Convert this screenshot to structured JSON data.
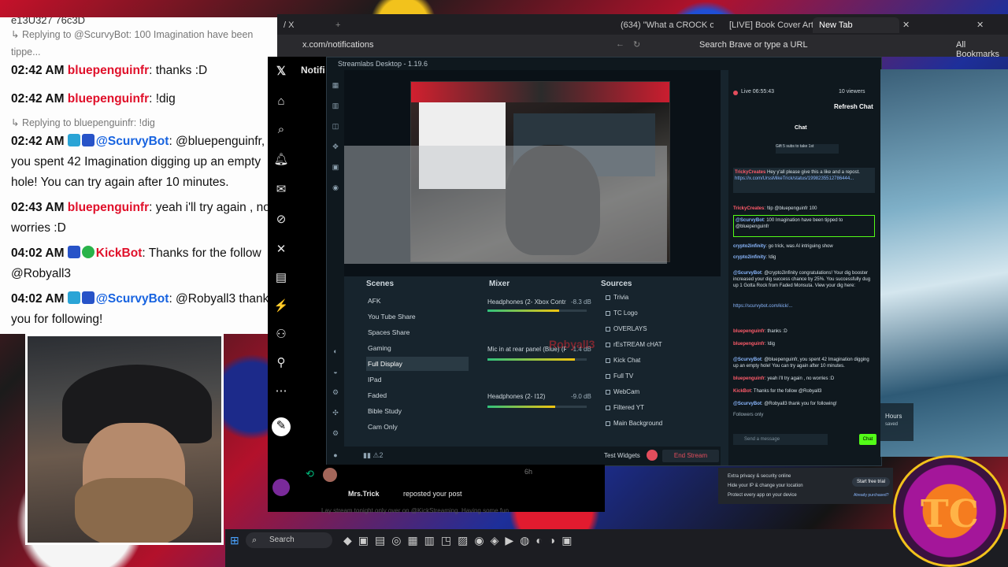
{
  "chat_overlay": {
    "top_cut": "e13U327 76c3D",
    "lines": [
      {
        "type": "reply",
        "text": "Replying to @ScurvyBot: 100 Imagination have been tippe..."
      },
      {
        "time": "02:42 AM",
        "user": "bluepenguinfr",
        "msg": ": thanks :D"
      },
      {
        "time": "02:42 AM",
        "user": "bluepenguinfr",
        "msg": ": !dig"
      },
      {
        "type": "reply",
        "text": "Replying to bluepenguinfr: !dig"
      },
      {
        "time": "02:42 AM",
        "user": "@ScurvyBot",
        "msg": ": @bluepenguinfr, you spent 42 Imagination digging up an empty hole! You can try again after 10 minutes."
      },
      {
        "time": "02:43 AM",
        "user": "bluepenguinfr",
        "msg": ": yeah i'll try again , no worries :D"
      },
      {
        "time": "04:02 AM",
        "user": "KickBot",
        "msg": ": Thanks for the follow @Robyall3"
      },
      {
        "time": "04:02 AM",
        "user": "@ScurvyBot",
        "msg": ": @Robyall3 thank you for following!"
      }
    ]
  },
  "browser": {
    "tabs": [
      {
        "label": "(634) \"What a CROCK of S***!\" Pi"
      },
      {
        "label": "[LIVE] Book Cover Art Project"
      },
      {
        "label": "New Tab",
        "active": true
      }
    ],
    "left_tab": "/ X",
    "url": "x.com/notifications",
    "search_placeholder": "Search Brave or type a URL",
    "bookmarks": "All Bookmarks"
  },
  "x_page": {
    "heading": "Notifi",
    "notification_user": "Mrs.Trick",
    "notification_action": "reposted your post",
    "notification_time": "6h",
    "notification_snippet": "Lay stream tonight only over on @KickStreaming. Having some fun"
  },
  "streamlabs": {
    "title": "Streamlabs Desktop - 1.19.6",
    "scenes_title": "Scenes",
    "scenes": [
      "AFK",
      "You Tube Share",
      "Spaces Share",
      "Gaming",
      "Full Display",
      "IPad",
      "Faded",
      "Bible Study",
      "Cam Only"
    ],
    "active_scene": "Full Display",
    "mixer_title": "Mixer",
    "mixer": [
      {
        "name": "Headphones (2- Xbox Contr...",
        "db": "-8.3 dB",
        "level": 0.72
      },
      {
        "name": "Mic in at rear panel (Blue) (R...",
        "db": "-1.4 dB",
        "level": 0.88
      },
      {
        "name": "Headphones (2- I12)",
        "db": "-9.0 dB",
        "level": 0.68
      }
    ],
    "sources_title": "Sources",
    "sources": [
      "Trivia",
      "TC Logo",
      "OVERLAYS",
      "rEsTREAM cHAT",
      "Kick Chat",
      "Full TV",
      "WebCam",
      "Filtered YT",
      "Main Background"
    ],
    "watermark": "Robyall3",
    "test_widgets": "Test Widgets",
    "end_stream": "End Stream",
    "live_time": "Live 06:55:43",
    "viewers": "10 viewers",
    "refresh_chat": "Refresh Chat",
    "chat_title": "Chat",
    "chat_notice": "Gift 5 subs to take 1st",
    "chat_input_placeholder": "Send a message",
    "chat_button": "Chat",
    "followers_label": "Followers only",
    "chat_lines": [
      {
        "user": "TrickyCreates",
        "text": "Hey y'all please give this a like and a repost."
      },
      {
        "user": "",
        "text": "https://x.com/UrssMikeTrick/status/1998235512786444..."
      },
      {
        "user": "TrickyCreates",
        "text": ": !tip @bluepenguinfr 100"
      },
      {
        "user": "@ScurvyBot",
        "text": ": 100 Imagination have been tipped to @bluepenguinfr"
      },
      {
        "user": "crypto2infinity",
        "text": ": go trick, was AI intriguing show"
      },
      {
        "user": "crypto2infinity",
        "text": ": !dig"
      },
      {
        "user": "@ScurvyBot",
        "text": ": @crypto2infinity congratulations! Your dig booster increased your dig success chance by 25%. You successfully dug up 1 Gotta Rock from Faded Monsuta. View your dig here:"
      },
      {
        "user": "",
        "text": "https://scurvybot.com/kick/..."
      },
      {
        "user": "bluepenguinfr",
        "text": ": thanks :D"
      },
      {
        "user": "bluepenguinfr",
        "text": ": !dig"
      },
      {
        "user": "@ScurvyBot",
        "text": ": @bluepenguinfr, you spent 42 Imagination digging up an empty hole! You can try again after 10 minutes."
      },
      {
        "user": "bluepenguinfr",
        "text": ": yeah i'll try again , no worries :D"
      },
      {
        "user": "KickBot",
        "text": ": Thanks for the follow @Robyall3"
      },
      {
        "user": "@ScurvyBot",
        "text": ": @Robyall3 thank you for following!"
      }
    ]
  },
  "ad": {
    "line1": "Extra privacy & security online",
    "line2": "Hide your IP & change your location",
    "line3": "Protect every app on your device",
    "button": "Start free trial",
    "link": "Already purchased?"
  },
  "right_side": {
    "hours": "Hours",
    "saved": "saved"
  },
  "taskbar": {
    "search": "Search"
  },
  "logo": {
    "text": "TC",
    "subtitle": "CREATIONS",
    "top": "TRICKY"
  },
  "colors": {
    "accent_red": "#e0102a",
    "streamlabs_bg": "#17242d",
    "live_green": "#53fc18"
  }
}
